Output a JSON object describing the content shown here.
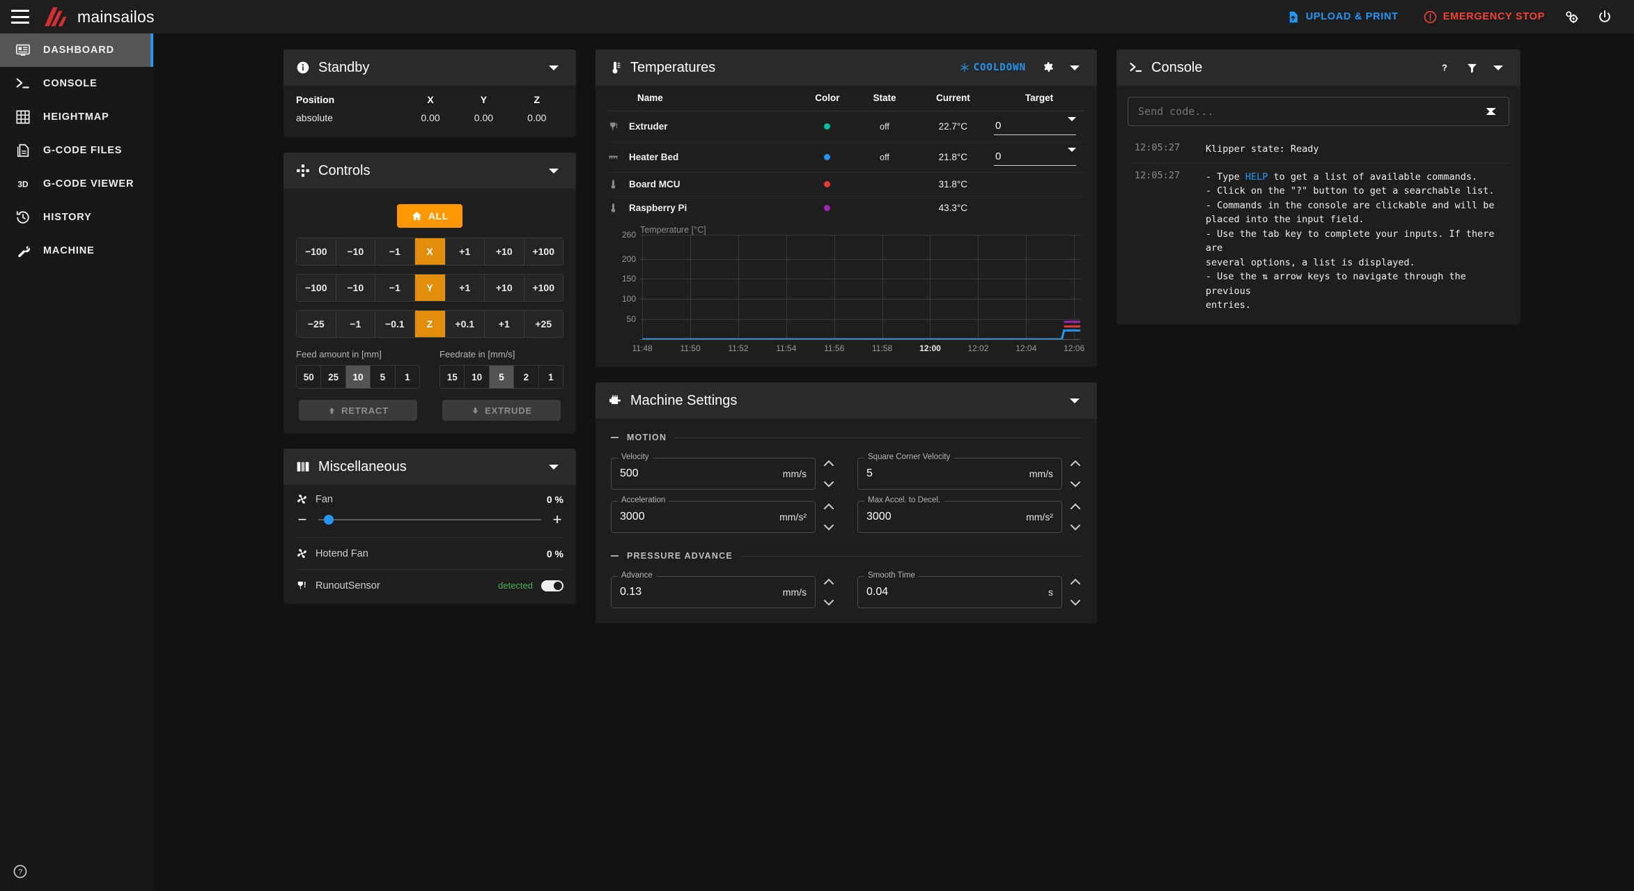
{
  "app": {
    "brand": "mainsailos",
    "menu_icon": "hamburger-icon"
  },
  "topbar": {
    "upload_print": "UPLOAD & PRINT",
    "emergency_stop": "EMERGENCY STOP",
    "settings_icon": "gears-icon",
    "power_icon": "power-icon",
    "upload_color": "#2196f3",
    "estop_color": "#f44336"
  },
  "sidebar": {
    "items": [
      {
        "label": "DASHBOARD",
        "icon": "dashboard-icon",
        "active": true
      },
      {
        "label": "CONSOLE",
        "icon": "terminal-icon",
        "active": false
      },
      {
        "label": "HEIGHTMAP",
        "icon": "grid-icon",
        "active": false
      },
      {
        "label": "G-CODE FILES",
        "icon": "file-icon",
        "active": false
      },
      {
        "label": "G-CODE VIEWER",
        "icon": "3d-icon",
        "active": false
      },
      {
        "label": "HISTORY",
        "icon": "history-icon",
        "active": false
      },
      {
        "label": "MACHINE",
        "icon": "wrench-icon",
        "active": false
      }
    ],
    "help_icon": "help-circle-icon",
    "active_accent": "#2196f3",
    "active_bg": "#555555"
  },
  "standby": {
    "title": "Standby",
    "icon": "info-icon",
    "collapse_icon": "chevron-down-icon",
    "headers": [
      "Position",
      "X",
      "Y",
      "Z"
    ],
    "row": [
      "absolute",
      "0.00",
      "0.00",
      "0.00"
    ]
  },
  "controls": {
    "title": "Controls",
    "icon": "controls-pad-icon",
    "collapse_icon": "chevron-down-icon",
    "home_all": "ALL",
    "home_icon": "home-icon",
    "axes": [
      {
        "label": "X",
        "left": [
          "−100",
          "−10",
          "−1"
        ],
        "right": [
          "+1",
          "+10",
          "+100"
        ]
      },
      {
        "label": "Y",
        "left": [
          "−100",
          "−10",
          "−1"
        ],
        "right": [
          "+1",
          "+10",
          "+100"
        ]
      },
      {
        "label": "Z",
        "left": [
          "−25",
          "−1",
          "−0.1"
        ],
        "right": [
          "+0.1",
          "+1",
          "+25"
        ]
      }
    ],
    "feed_amount_label": "Feed amount in [mm]",
    "feed_amount_values": [
      "50",
      "25",
      "10",
      "5",
      "1"
    ],
    "feed_amount_selected": "10",
    "feedrate_label": "Feedrate in [mm/s]",
    "feedrate_values": [
      "15",
      "10",
      "5",
      "2",
      "1"
    ],
    "feedrate_selected": "5",
    "retract": "RETRACT",
    "retract_icon": "arrow-up-icon",
    "extrude": "EXTRUDE",
    "extrude_icon": "arrow-down-icon"
  },
  "miscellaneous": {
    "title": "Miscellaneous",
    "icon": "sliders-icon",
    "collapse_icon": "chevron-down-icon",
    "fan": {
      "label": "Fan",
      "value": "0 %",
      "icon": "fan-icon",
      "slider_percent": 0,
      "minus": "−",
      "plus": "+",
      "thumb_color": "#2196f3"
    },
    "hotend_fan": {
      "label": "Hotend Fan",
      "value": "0 %",
      "icon": "fan-icon"
    },
    "runout_sensor": {
      "label": "RunoutSensor",
      "status": "detected",
      "icon": "filament-sensor-icon",
      "status_color": "#4caf50",
      "toggle_on": true
    }
  },
  "temperatures": {
    "title": "Temperatures",
    "icon": "thermometer-icon",
    "cooldown": "COOLDOWN",
    "cooldown_icon": "snowflake-icon",
    "settings_icon": "gear-icon",
    "collapse_icon": "chevron-down-icon",
    "headers": [
      "Name",
      "Color",
      "State",
      "Current",
      "Target"
    ],
    "rows": [
      {
        "name": "Extruder",
        "icon": "extruder-icon",
        "color": "#00bfa5",
        "state": "off",
        "current": "22.7°C",
        "target": "0",
        "has_target": true
      },
      {
        "name": "Heater Bed",
        "icon": "bed-icon",
        "color": "#2196f3",
        "state": "off",
        "current": "21.8°C",
        "target": "0",
        "has_target": true
      },
      {
        "name": "Board MCU",
        "icon": "sensor-icon",
        "color": "#e53935",
        "state": "",
        "current": "31.8°C",
        "target": "",
        "has_target": false
      },
      {
        "name": "Raspberry Pi",
        "icon": "sensor-icon",
        "color": "#9c27b0",
        "state": "",
        "current": "43.3°C",
        "target": "",
        "has_target": false
      }
    ]
  },
  "chart_data": {
    "type": "line",
    "title": "Temperature [°C]",
    "xlabel": "",
    "ylabel": "Temperature [°C]",
    "ylim": [
      0,
      260
    ],
    "yticks": [
      0,
      50,
      100,
      150,
      200,
      260
    ],
    "ytick_labels": [
      "",
      "50",
      "100",
      "150",
      "200",
      "260"
    ],
    "xticks": [
      "11:48",
      "11:50",
      "11:52",
      "11:54",
      "11:56",
      "11:58",
      "12:00",
      "12:02",
      "12:04",
      "12:06"
    ],
    "xtick_bold": "12:00",
    "grid": true,
    "legend": "none",
    "series": [
      {
        "name": "Heater Bed",
        "color": "#2196f3",
        "x": [
          "11:48",
          "12:06.8",
          "12:07.0",
          "12:07.4"
        ],
        "values": [
          0,
          0,
          21.8,
          21.8
        ]
      },
      {
        "name": "Board MCU",
        "color": "#e53935",
        "x": [
          "12:07.0",
          "12:07.4"
        ],
        "values": [
          31.8,
          31.8
        ]
      },
      {
        "name": "Raspberry Pi",
        "color": "#9c27b0",
        "x": [
          "12:07.0",
          "12:07.4"
        ],
        "values": [
          43.3,
          43.3
        ]
      }
    ]
  },
  "machine_settings": {
    "title": "Machine Settings",
    "icon": "motor-icon",
    "collapse_icon": "chevron-down-icon",
    "sections": [
      {
        "name": "MOTION",
        "fields": [
          {
            "label": "Velocity",
            "value": "500",
            "unit": "mm/s"
          },
          {
            "label": "Square Corner Velocity",
            "value": "5",
            "unit": "mm/s"
          },
          {
            "label": "Acceleration",
            "value": "3000",
            "unit": "mm/s²"
          },
          {
            "label": "Max Accel. to Decel.",
            "value": "3000",
            "unit": "mm/s²"
          }
        ]
      },
      {
        "name": "PRESSURE ADVANCE",
        "fields": [
          {
            "label": "Advance",
            "value": "0.13",
            "unit": "mm/s"
          },
          {
            "label": "Smooth Time",
            "value": "0.04",
            "unit": "s"
          }
        ]
      }
    ]
  },
  "console": {
    "title": "Console",
    "icon": "terminal-icon",
    "help_icon": "question-icon",
    "filter_icon": "filter-icon",
    "collapse_icon": "chevron-down-icon",
    "input_placeholder": "Send code...",
    "send_icon": "send-icon",
    "lines": [
      {
        "time": "12:05:27",
        "text": "Klipper state: Ready",
        "pre": "",
        "cmd": "",
        "post": ""
      },
      {
        "time": "12:05:27",
        "pre": "- Type ",
        "cmd": "HELP",
        "post": " to get a list of available commands.\n- Click on the \"?\" button to get a searchable list.\n- Commands in the console are clickable and will be\nplaced into the input field.\n- Use the tab key to complete your inputs. If there are\nseveral options, a list is displayed.\n- Use the ⇅ arrow keys to navigate through the previous\nentries."
      }
    ]
  }
}
